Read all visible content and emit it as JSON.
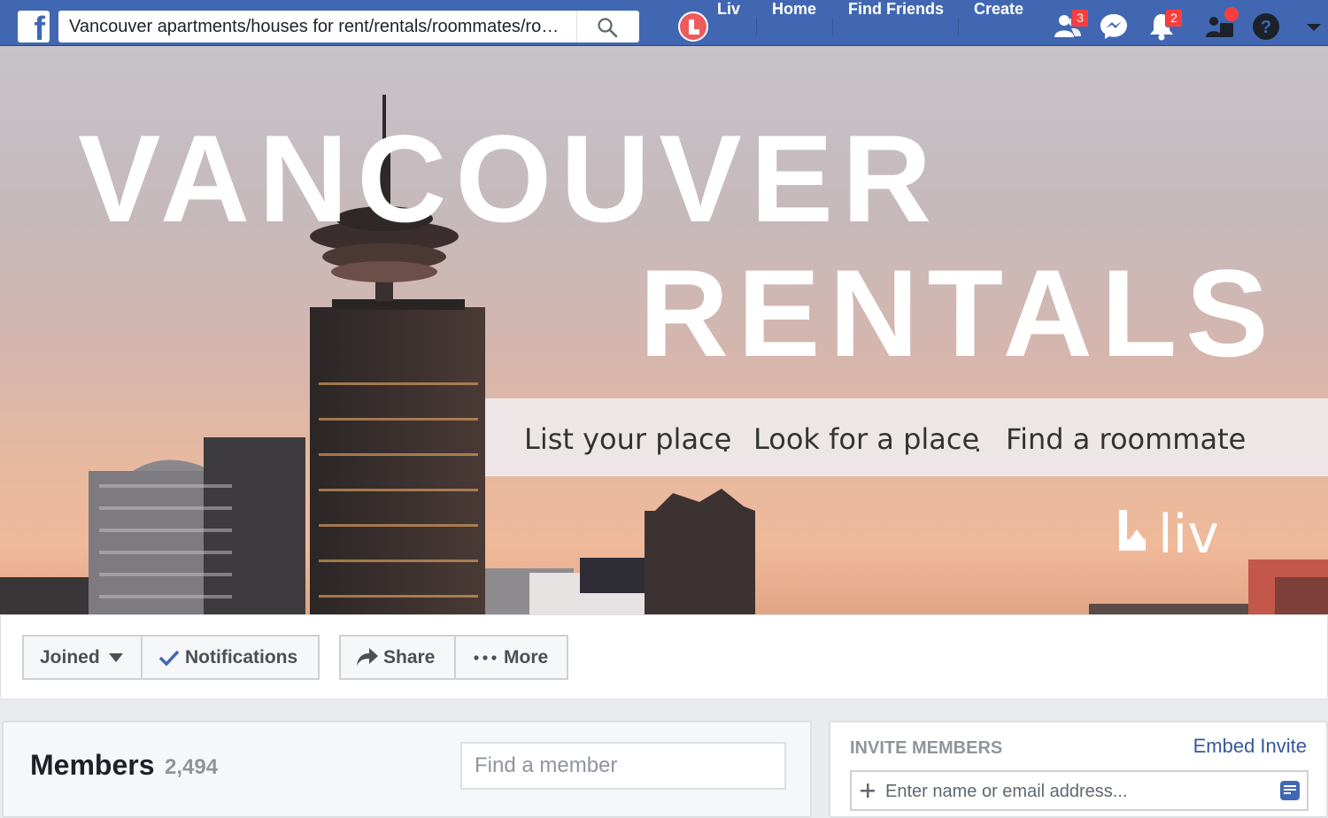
{
  "topbar": {
    "logo_icon": "facebook-f-icon",
    "search_value": "Vancouver apartments/houses for rent/rentals/roommates/ro…",
    "search_icon": "search-icon",
    "profile_name": "Liv",
    "nav": [
      "Home",
      "Find Friends",
      "Create"
    ],
    "friend_requests_badge": "3",
    "notifications_badge": "2",
    "icons": [
      "friend-requests-icon",
      "messenger-icon",
      "notifications-icon",
      "quick-help-icon",
      "help-icon",
      "account-menu-icon"
    ]
  },
  "cover": {
    "title_line1": "VANCOUVER",
    "title_line2": "RENTALS",
    "tagline": [
      "List your place",
      "Look for a place",
      "Find a roommate"
    ],
    "separator": ".",
    "brand_logo": "liv"
  },
  "actions": {
    "joined": "Joined",
    "notifications": "Notifications",
    "share": "Share",
    "more": "More"
  },
  "members": {
    "title": "Members",
    "count": "2,494",
    "search_placeholder": "Find a member"
  },
  "invite": {
    "title": "INVITE MEMBERS",
    "embed_link": "Embed Invite",
    "input_placeholder": "Enter name or email address..."
  },
  "colors": {
    "brand": "#4267b2",
    "badge": "#fa3e3e",
    "link": "#365899",
    "liv_accent": "#f05a5a"
  }
}
